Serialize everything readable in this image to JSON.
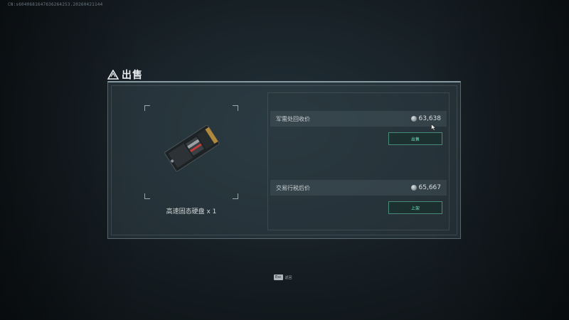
{
  "watermark": "CN:s6040681647636264253.20260421144",
  "dialog": {
    "title": "出售",
    "icon": "warning-triangle-icon"
  },
  "item": {
    "name": "高速固态硬盘 x 1",
    "image_icon": "ssd-drive-icon"
  },
  "offers": [
    {
      "label": "军需处回收价",
      "price": "63,638",
      "currency_icon": "coin-icon",
      "button_label": "出售"
    },
    {
      "label": "交易行税后价",
      "price": "65,667",
      "currency_icon": "coin-icon",
      "button_label": "上架"
    }
  ],
  "footer": {
    "key": "Esc",
    "label": "返回"
  },
  "colors": {
    "accent_green": "#6fe0b8",
    "button_border": "#4a8a78",
    "panel_border": "#aabec6"
  }
}
